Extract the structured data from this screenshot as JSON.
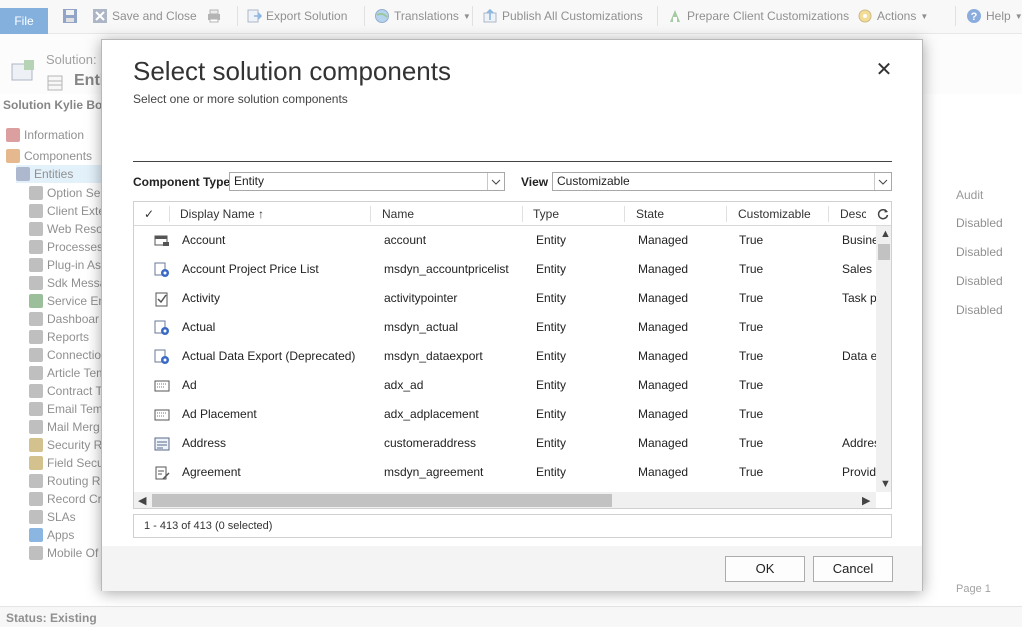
{
  "ribbon": {
    "file": "File",
    "save_and_close": "Save and Close",
    "export_solution": "Export Solution",
    "translations": "Translations",
    "publish_all": "Publish All Customizations",
    "prepare_client": "Prepare Client Customizations",
    "actions": "Actions",
    "help": "Help"
  },
  "page": {
    "solution_label": "Solution:",
    "entity_label": "Enti",
    "solution_name": "Solution Kylie Bot",
    "status": "Status: Existing",
    "audit_header": "Audit",
    "disabled": [
      "Disabled",
      "Disabled",
      "Disabled",
      "Disabled"
    ],
    "page_label": "Page 1"
  },
  "nav": [
    {
      "label": "Information",
      "color": "#c05050"
    },
    {
      "label": "Components",
      "color": "#d08030"
    },
    {
      "label": "Entities",
      "color": "#6a7fa8"
    },
    {
      "label": "Option Se",
      "color": "#8a8a8a"
    },
    {
      "label": "Client Exte",
      "color": "#8a8a8a"
    },
    {
      "label": "Web Reso",
      "color": "#8a8a8a"
    },
    {
      "label": "Processes",
      "color": "#8a8a8a"
    },
    {
      "label": "Plug-in As",
      "color": "#8a8a8a"
    },
    {
      "label": "Sdk Messa",
      "color": "#8a8a8a"
    },
    {
      "label": "Service En",
      "color": "#4a8a4a"
    },
    {
      "label": "Dashboar",
      "color": "#8a8a8a"
    },
    {
      "label": "Reports",
      "color": "#8a8a8a"
    },
    {
      "label": "Connection",
      "color": "#8a8a8a"
    },
    {
      "label": "Article Tem",
      "color": "#8a8a8a"
    },
    {
      "label": "Contract T",
      "color": "#8a8a8a"
    },
    {
      "label": "Email Temp",
      "color": "#8a8a8a"
    },
    {
      "label": "Mail Merg",
      "color": "#8a8a8a"
    },
    {
      "label": "Security Ro",
      "color": "#b09030"
    },
    {
      "label": "Field Secu",
      "color": "#b09030"
    },
    {
      "label": "Routing R",
      "color": "#8a8a8a"
    },
    {
      "label": "Record Cre",
      "color": "#8a8a8a"
    },
    {
      "label": "SLAs",
      "color": "#8a8a8a"
    },
    {
      "label": "Apps",
      "color": "#2a7ac8"
    },
    {
      "label": "Mobile Of",
      "color": "#8a8a8a"
    }
  ],
  "dialog": {
    "title": "Select solution components",
    "subtitle": "Select one or more solution components",
    "component_type_label": "Component Type",
    "component_type_value": "Entity",
    "view_label": "View",
    "view_value": "Customizable",
    "columns": [
      "Display Name ↑",
      "Name",
      "Type",
      "State",
      "Customizable",
      "Desc"
    ],
    "rows": [
      {
        "display": "Account",
        "name": "account",
        "type": "Entity",
        "state": "Managed",
        "custom": "True",
        "desc": "Busine",
        "icon": "account-icon"
      },
      {
        "display": "Account Project Price List",
        "name": "msdyn_accountpricelist",
        "type": "Entity",
        "state": "Managed",
        "custom": "True",
        "desc": "Sales p",
        "icon": "gear-entity-icon"
      },
      {
        "display": "Activity",
        "name": "activitypointer",
        "type": "Entity",
        "state": "Managed",
        "custom": "True",
        "desc": "Task pe",
        "icon": "activity-icon"
      },
      {
        "display": "Actual",
        "name": "msdyn_actual",
        "type": "Entity",
        "state": "Managed",
        "custom": "True",
        "desc": "",
        "icon": "gear-entity-icon"
      },
      {
        "display": "Actual Data Export (Deprecated)",
        "name": "msdyn_dataexport",
        "type": "Entity",
        "state": "Managed",
        "custom": "True",
        "desc": "Data e",
        "icon": "gear-entity-icon"
      },
      {
        "display": "Ad",
        "name": "adx_ad",
        "type": "Entity",
        "state": "Managed",
        "custom": "True",
        "desc": "",
        "icon": "form-icon"
      },
      {
        "display": "Ad Placement",
        "name": "adx_adplacement",
        "type": "Entity",
        "state": "Managed",
        "custom": "True",
        "desc": "",
        "icon": "form-icon"
      },
      {
        "display": "Address",
        "name": "customeraddress",
        "type": "Entity",
        "state": "Managed",
        "custom": "True",
        "desc": "Addres",
        "icon": "address-icon"
      },
      {
        "display": "Agreement",
        "name": "msdyn_agreement",
        "type": "Entity",
        "state": "Managed",
        "custom": "True",
        "desc": "Provid",
        "icon": "agreement-icon"
      }
    ],
    "footer_count": "1 - 413 of 413 (0 selected)",
    "ok": "OK",
    "cancel": "Cancel"
  },
  "colors": {
    "file_tab": "#1f6fc4",
    "selected_nav": "#cde6f7"
  }
}
